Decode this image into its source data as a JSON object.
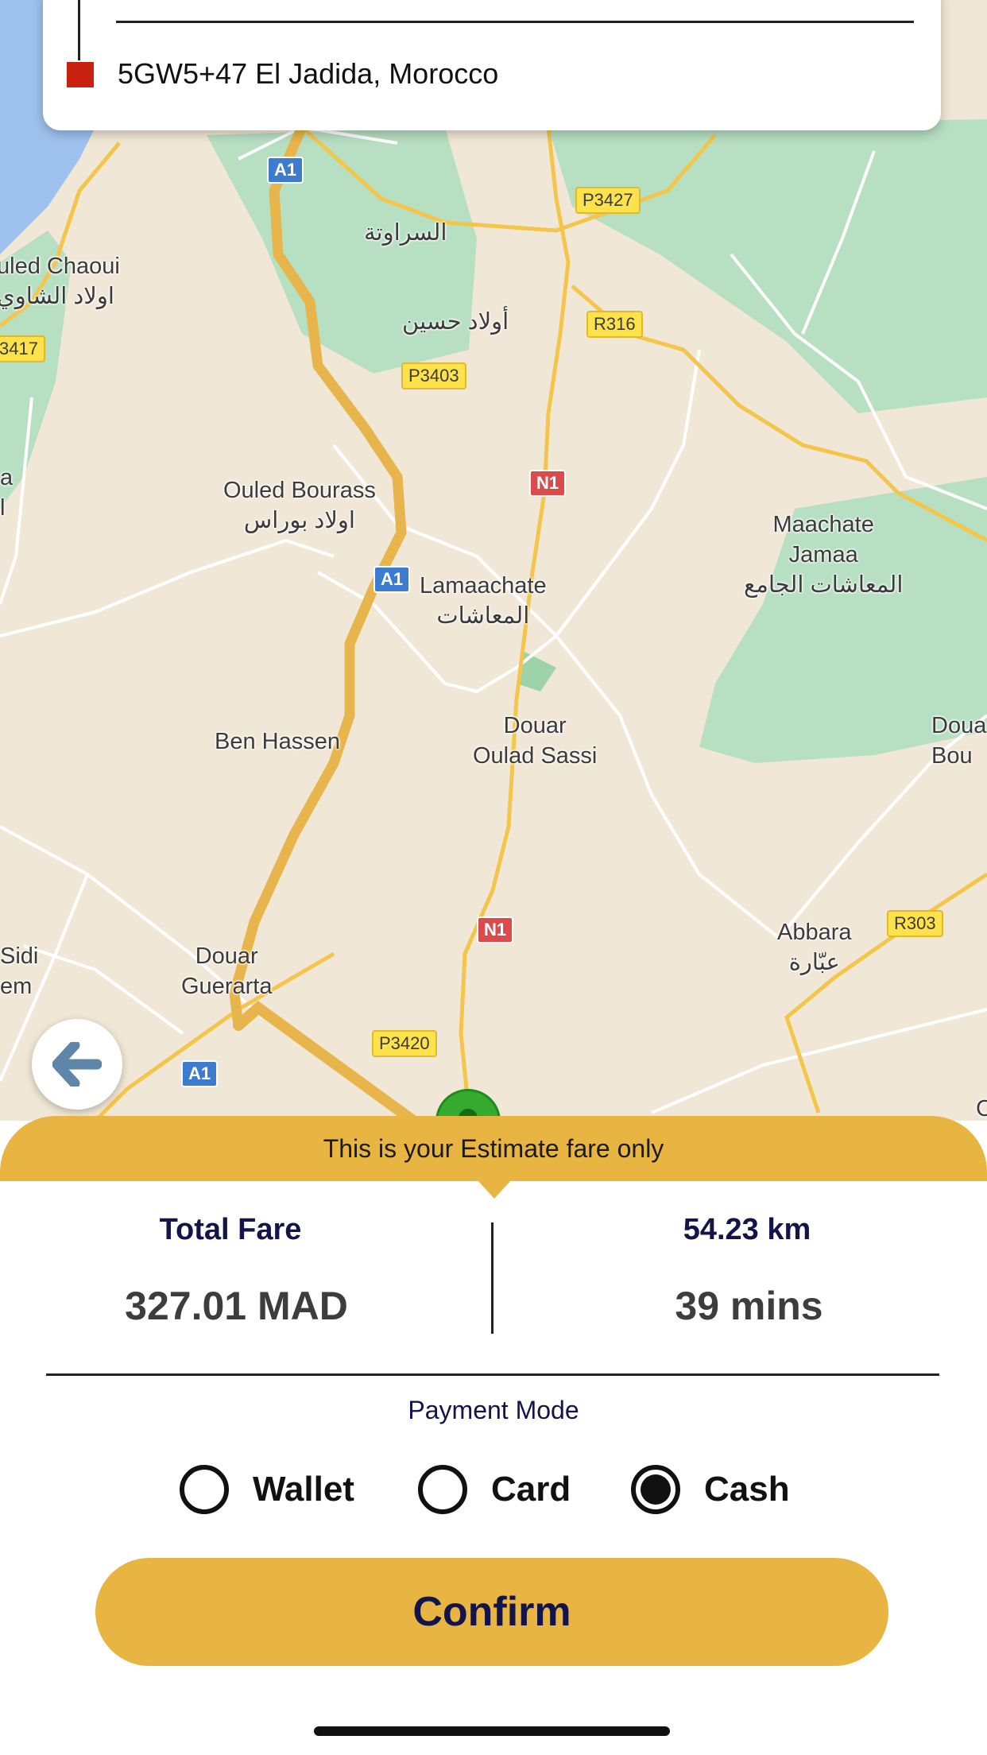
{
  "address_card": {
    "destination": "5GW5+47 El Jadida, Morocco"
  },
  "map": {
    "places": [
      {
        "id": "sraouta",
        "text": "السراوتة"
      },
      {
        "id": "ouled-chaoui",
        "text": "uled Chaoui\nاولاد الشاوي"
      },
      {
        "id": "ouled-hssine",
        "text": "أولاد حسين"
      },
      {
        "id": "ouled-bourass",
        "text": "Ouled Bourass\nاولاد بوراس"
      },
      {
        "id": "lamaachate",
        "text": "Lamaachate\nالمعاشات"
      },
      {
        "id": "maachate-jamaa",
        "text": "Maachate\nJamaa\nالمعاشات الجامع"
      },
      {
        "id": "ben-hassen",
        "text": "Ben Hassen"
      },
      {
        "id": "douar-oulad-sassi",
        "text": "Douar\nOulad Sassi"
      },
      {
        "id": "douar-right",
        "text": "Doua\nBou"
      },
      {
        "id": "abbara",
        "text": "Abbara\nعبّارة"
      },
      {
        "id": "sidi",
        "text": "Sidi\nem"
      },
      {
        "id": "douar-guerarta",
        "text": "Douar\nGuerarta"
      },
      {
        "id": "edge-a",
        "text": "a\nl"
      },
      {
        "id": "edge-c",
        "text": "C"
      }
    ],
    "road_shields": [
      {
        "id": "a1-top",
        "text": "A1",
        "kind": "blue"
      },
      {
        "id": "p3427",
        "text": "P3427",
        "kind": "yellow"
      },
      {
        "id": "r316",
        "text": "R316",
        "kind": "yellow"
      },
      {
        "id": "p3417",
        "text": "3417",
        "kind": "yellow"
      },
      {
        "id": "p3403",
        "text": "P3403",
        "kind": "yellow"
      },
      {
        "id": "n1-top",
        "text": "N1",
        "kind": "red"
      },
      {
        "id": "a1-mid",
        "text": "A1",
        "kind": "blue"
      },
      {
        "id": "n1-bottom",
        "text": "N1",
        "kind": "red"
      },
      {
        "id": "r303",
        "text": "R303",
        "kind": "yellow"
      },
      {
        "id": "p3420",
        "text": "P3420",
        "kind": "yellow"
      },
      {
        "id": "a1-bottom",
        "text": "A1",
        "kind": "blue"
      }
    ]
  },
  "banner": {
    "text": "This is your Estimate fare only"
  },
  "fare": {
    "total_label": "Total Fare",
    "total_value": "327.01 MAD",
    "distance": "54.23 km",
    "duration": "39 mins"
  },
  "payment": {
    "title": "Payment Mode",
    "options": [
      {
        "label": "Wallet",
        "selected": false
      },
      {
        "label": "Card",
        "selected": false
      },
      {
        "label": "Cash",
        "selected": true
      }
    ]
  },
  "confirm_label": "Confirm",
  "colors": {
    "accent": "#e8b543",
    "navy_text": "#13154a",
    "map_land": "#f1e7d6",
    "map_green": "#b7dfc2",
    "map_water": "#9fc1ee",
    "pickup_pin": "#34ab2e",
    "destination_marker": "#c8210f"
  },
  "icons": {
    "back": "arrow-left-icon",
    "pickup": "pickup-pin-icon",
    "destination": "destination-square-icon"
  }
}
